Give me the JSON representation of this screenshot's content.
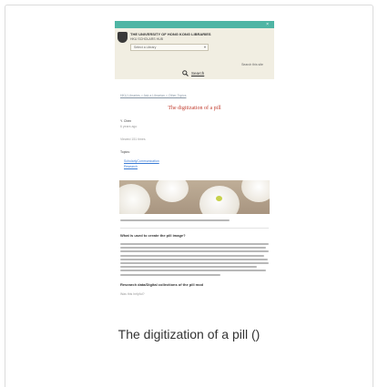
{
  "screenshot": {
    "site_title": "THE UNIVERSITY OF HONG KONG LIBRARIES",
    "site_subtitle": "HKU SCHOLARS HUB",
    "dropdown_value": "Select a Library",
    "search_hint": "Search this site",
    "search_link": "Search",
    "breadcrumb": "HKU Libraries > Ask a Librarian > Other Topics",
    "heading": "The digitization of a pill",
    "author": "Y. Chen",
    "date": "6 years ago",
    "views": "Viewed 151 times",
    "topics_label": "Topics:",
    "topic_links": [
      "ScholarlyCommunication",
      "Research"
    ],
    "subhead_1": "What is used to create the pill image?",
    "subhead_2": "Research data/Digital collections of the pill mod",
    "footer_text": "Was this helpful?",
    "colors": {
      "banner": "#4fb5a4",
      "header_bg": "#f1eee2",
      "heading": "#c0392b",
      "link": "#3a7bd5"
    }
  },
  "caption": "The digitization of a pill ()"
}
